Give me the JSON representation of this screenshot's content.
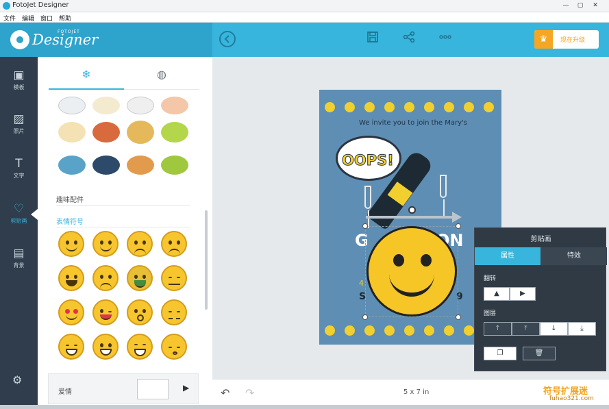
{
  "window": {
    "title": "FotoJet Designer",
    "controls": [
      "—",
      "▢",
      "✕"
    ]
  },
  "menu": [
    "文件",
    "编辑",
    "窗口",
    "帮助"
  ],
  "header": {
    "brand": "Designer",
    "brand_small": "FOTOJET",
    "back_icon": "chevron-left-icon",
    "actions": [
      "save-icon",
      "share-icon",
      "more-icon"
    ],
    "upgrade_label": "现在升级",
    "upgrade_icon": "crown-icon"
  },
  "sidebar": {
    "items": [
      {
        "label": "模板",
        "icon": "template-icon"
      },
      {
        "label": "照片",
        "icon": "photo-icon"
      },
      {
        "label": "文字",
        "icon": "text-icon"
      },
      {
        "label": "剪贴画",
        "icon": "heart-icon"
      },
      {
        "label": "背景",
        "icon": "background-icon"
      }
    ],
    "active": "剪贴画",
    "settings_icon": "gear-icon"
  },
  "panel": {
    "tabs": [
      "snowflake-icon",
      "globe-icon"
    ],
    "active_tab": 0,
    "sections": [
      {
        "label": "趣味配件"
      },
      {
        "label": "表情符号",
        "active": true
      }
    ],
    "emoji_count": 16,
    "category_row": {
      "label": "爱情",
      "arrow": "▶"
    }
  },
  "canvas": {
    "invite_text": "We invite you to join the Mary's",
    "oops_text": "OOPS!",
    "big_text_left": "G",
    "big_text_right": "ON",
    "side_text_left": "4",
    "side_text_right": "9",
    "side_date_left": "S",
    "colors": {
      "card": "#5e8eb4",
      "dot": "#f1cf2e",
      "accent": "#37b5dc"
    }
  },
  "bottombar": {
    "undo_icon": "undo-icon",
    "redo_icon": "redo-icon",
    "size_label": "5 x 7 in"
  },
  "props_panel": {
    "title": "剪贴画",
    "tabs": [
      "属性",
      "特效"
    ],
    "active_tab": "属性",
    "flip_label": "翻转",
    "layer_label": "图层"
  },
  "watermark": {
    "line1": "符号扩展迷",
    "line2": "fuhao321.com"
  }
}
